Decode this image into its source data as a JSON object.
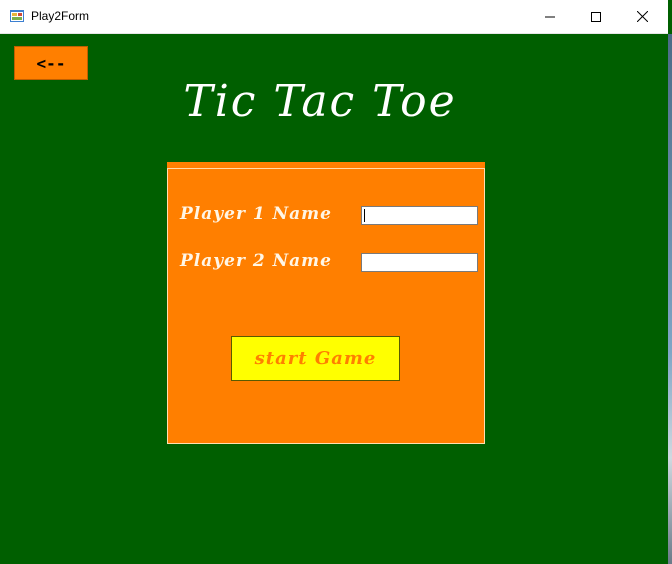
{
  "window": {
    "title": "Play2Form",
    "controls": {
      "minimize": "—",
      "maximize": "☐",
      "close": "✕"
    }
  },
  "back_button": {
    "label": "<--"
  },
  "game_title": "Tic Tac Toe",
  "form": {
    "player1": {
      "label": "Player 1 Name",
      "value": ""
    },
    "player2": {
      "label": "Player 2 Name",
      "value": ""
    },
    "start_button": "start Game"
  },
  "colors": {
    "background": "#005f00",
    "panel": "#ff7f00",
    "start_button": "#ffff00",
    "start_text": "#ff7f00",
    "back_button": "#ff7f00"
  },
  "icons": {
    "app": "form-app-icon",
    "minimize": "minimize-icon",
    "maximize": "maximize-icon",
    "close": "close-icon"
  }
}
